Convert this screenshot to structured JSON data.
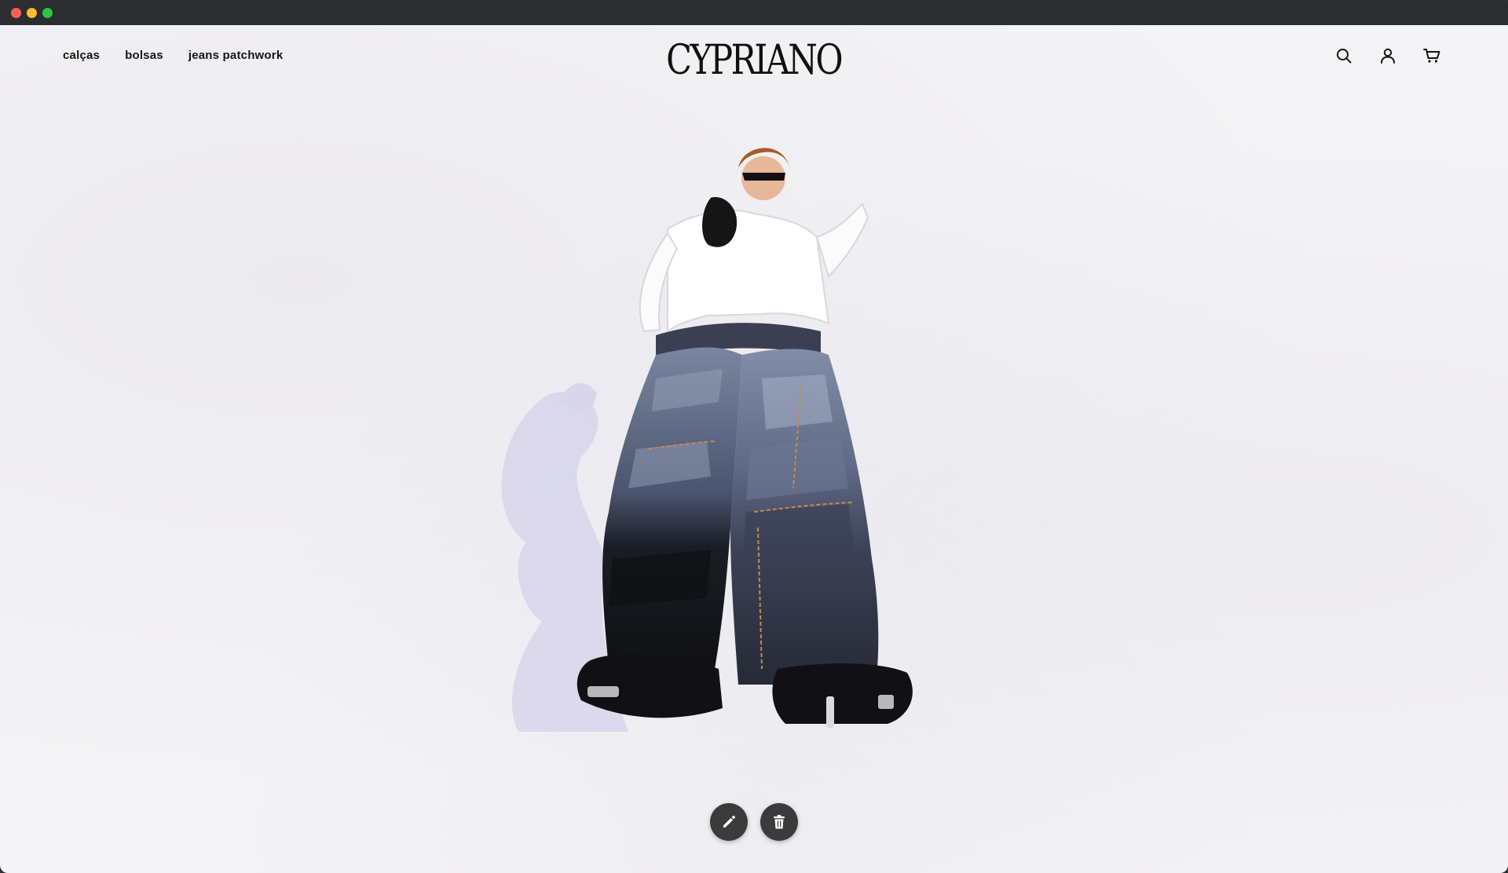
{
  "nav": {
    "items": [
      {
        "label": "calças"
      },
      {
        "label": "bolsas"
      },
      {
        "label": "jeans patchwork"
      }
    ]
  },
  "brand": {
    "logo_text": "CYPRIANO"
  },
  "header_icons": [
    "search-icon",
    "user-icon",
    "cart-icon"
  ],
  "actions": {
    "edit_icon": "pencil-icon",
    "delete_icon": "trash-icon",
    "button_color": "#3b3b3b"
  },
  "hero": {
    "image": "model-in-oversized-patchwork-jeans"
  },
  "colors": {
    "background": "#f4f3f5",
    "text": "#151515",
    "shadow": "#d8d6ea"
  }
}
